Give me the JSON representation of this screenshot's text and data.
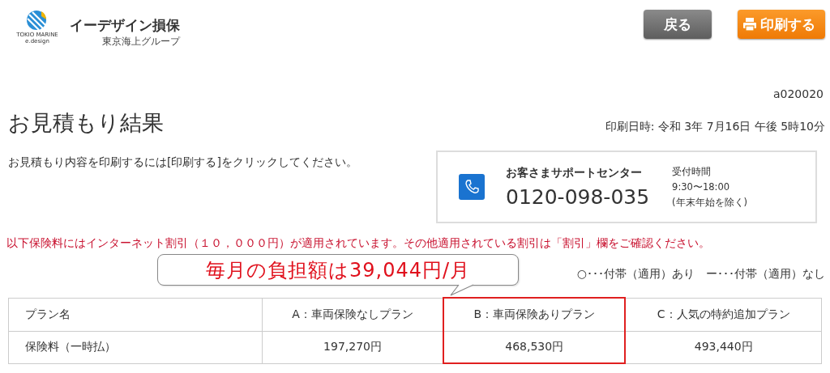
{
  "header": {
    "logo": {
      "mark_text": "TOKIO MARINE",
      "mark_subtext": "e.design",
      "name": "イーデザイン損保",
      "group": "東京海上グループ"
    },
    "buttons": [
      {
        "kind": "back",
        "label": "戻る"
      },
      {
        "kind": "print",
        "label": "印刷する"
      }
    ]
  },
  "page_code": "a020020",
  "title": "お見積もり結果",
  "print_datetime": "印刷日時: 令和 3年 7月16日 午後 5時10分",
  "instruction": "お見積もり内容を印刷するには[印刷する]をクリックしてください。",
  "support": {
    "name": "お客さまサポートセンター",
    "phone": "0120-098-035",
    "hours_label": "受付時間",
    "hours": "9:30〜18:00",
    "hours_note": "(年末年始を除く)"
  },
  "notice": "以下保険料にはインターネット割引（１０，０００円）が適用されています。その他適用されている割引は「割引」欄をご確認ください。",
  "callout": "毎月の負担額は39,044円/月",
  "legend": [
    "○･･･付帯（適用）あり",
    "ー･･･付帯（適用）なし"
  ],
  "table": {
    "columns": [
      {
        "label": "プラン名",
        "highlighted": false
      },
      {
        "label": "A：車両保険なしプラン",
        "highlighted": false
      },
      {
        "label": "B：車両保険ありプラン",
        "highlighted": true
      },
      {
        "label": "C：人気の特約追加プラン",
        "highlighted": false
      }
    ],
    "rows": [
      [
        "保険料（一時払）",
        "197,270円",
        "468,530円",
        "493,440円"
      ]
    ]
  }
}
